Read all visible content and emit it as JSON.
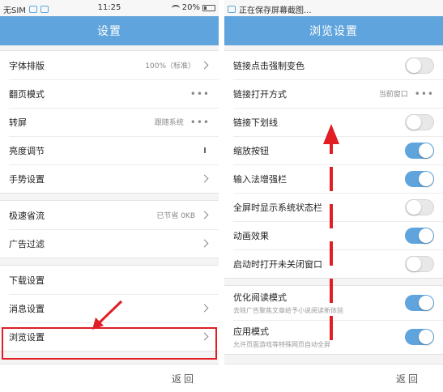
{
  "left": {
    "status": {
      "carrier": "无SIM",
      "time": "11:25",
      "battery": "20%"
    },
    "title": "设置",
    "groups": [
      [
        {
          "label": "字体排版",
          "value": "100%（标准）"
        },
        {
          "label": "翻页模式"
        },
        {
          "label": "转屏",
          "value": "跟随系统"
        },
        {
          "label": "亮度调节"
        },
        {
          "label": "手势设置"
        }
      ],
      [
        {
          "label": "极速省流",
          "value": "已节省 0KB"
        },
        {
          "label": "广告过滤"
        }
      ],
      [
        {
          "label": "下载设置"
        },
        {
          "label": "消息设置"
        },
        {
          "label": "浏览设置"
        }
      ]
    ],
    "back": "返回"
  },
  "right": {
    "status": {
      "notification": "正在保存屏幕截图..."
    },
    "title": "浏览设置",
    "rows": [
      {
        "label": "链接点击强制变色",
        "toggle": "off"
      },
      {
        "label": "链接打开方式",
        "value": "当前窗口"
      },
      {
        "label": "链接下划线",
        "toggle": "off"
      },
      {
        "label": "缩放按钮",
        "toggle": "on"
      },
      {
        "label": "输入法增强栏",
        "toggle": "on"
      },
      {
        "label": "全屏时显示系统状态栏",
        "toggle": "off"
      },
      {
        "label": "动画效果",
        "toggle": "on"
      },
      {
        "label": "启动时打开未关闭窗口",
        "toggle": "off"
      }
    ],
    "rows2": [
      {
        "label": "优化阅读模式",
        "sub": "去除广告聚焦文章给予小说阅读新体验",
        "toggle": "on"
      },
      {
        "label": "应用模式",
        "sub": "允许页面游戏等特殊网页自动全屏",
        "toggle": "on"
      }
    ],
    "back": "返回"
  },
  "colors": {
    "accent": "#5fa4dc",
    "annotation": "#e01e24"
  }
}
